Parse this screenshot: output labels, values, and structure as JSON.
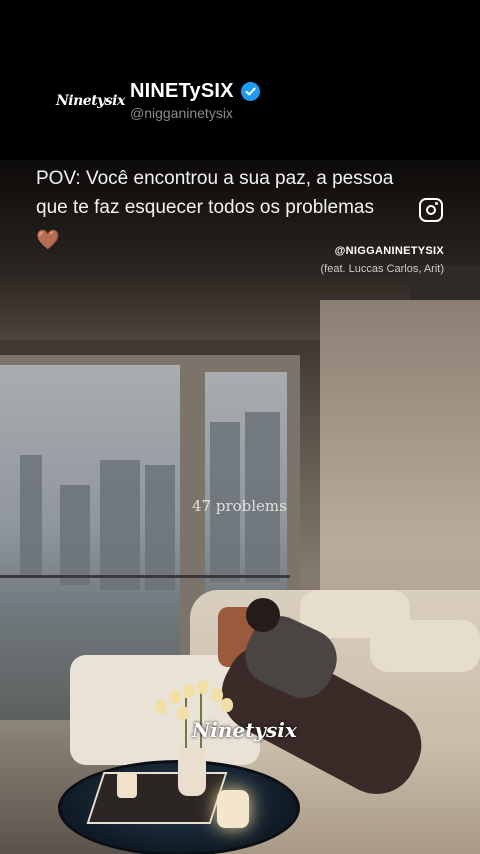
{
  "profile": {
    "logo_text": "Ninetysix",
    "name": "NINETySIX",
    "verified_icon": "verified-badge-icon",
    "handle": "@nigganinetysix"
  },
  "caption": {
    "line1": "POV:  Você encontrou a sua paz, a pessoa",
    "line2": "que te faz esquecer todos os problemas",
    "emoji": "🤎"
  },
  "music": {
    "handle": "@NIGGANINETYSIX",
    "feat": "(feat. Luccas Carlos, Arit)"
  },
  "video": {
    "overlay_text": "47 problems",
    "watermark": "Ninetysix"
  },
  "colors": {
    "verified": "#1d9bf0",
    "background": "#000000"
  }
}
